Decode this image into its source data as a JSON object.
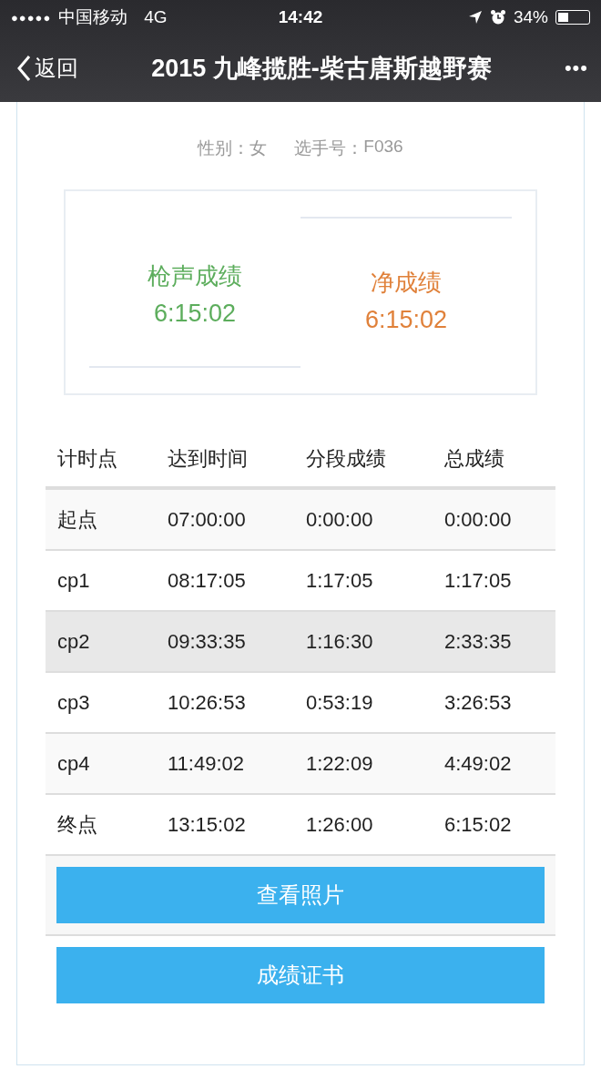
{
  "status_bar": {
    "signal_dots": "●●●●●",
    "carrier": "中国移动",
    "network": "4G",
    "time": "14:42",
    "battery": "34%"
  },
  "nav_bar": {
    "back": "返回",
    "title": "2015 九峰揽胜-柴古唐斯越野赛",
    "more": "•••"
  },
  "info": {
    "gender_label": "性别：",
    "gender": "女",
    "number_label": "选手号：",
    "number": "F036"
  },
  "scores": [
    {
      "kind": "gun",
      "label": "枪声成绩",
      "value": "6:15:02"
    },
    {
      "kind": "net",
      "label": "净成绩",
      "value": "6:15:02"
    }
  ],
  "table": {
    "columns": [
      "计时点",
      "达到时间",
      "分段成绩",
      "总成绩"
    ],
    "rows": [
      {
        "cells": [
          "起点",
          "07:00:00",
          "0:00:00",
          "0:00:00"
        ],
        "selected": false
      },
      {
        "cells": [
          "cp1",
          "08:17:05",
          "1:17:05",
          "1:17:05"
        ],
        "selected": false
      },
      {
        "cells": [
          "cp2",
          "09:33:35",
          "1:16:30",
          "2:33:35"
        ],
        "selected": true
      },
      {
        "cells": [
          "cp3",
          "10:26:53",
          "0:53:19",
          "3:26:53"
        ],
        "selected": false
      },
      {
        "cells": [
          "cp4",
          "11:49:02",
          "1:22:09",
          "4:49:02"
        ],
        "selected": false
      },
      {
        "cells": [
          "终点",
          "13:15:02",
          "1:26:00",
          "6:15:02"
        ],
        "selected": false
      }
    ]
  },
  "buttons": [
    "查看照片",
    "成绩证书"
  ]
}
